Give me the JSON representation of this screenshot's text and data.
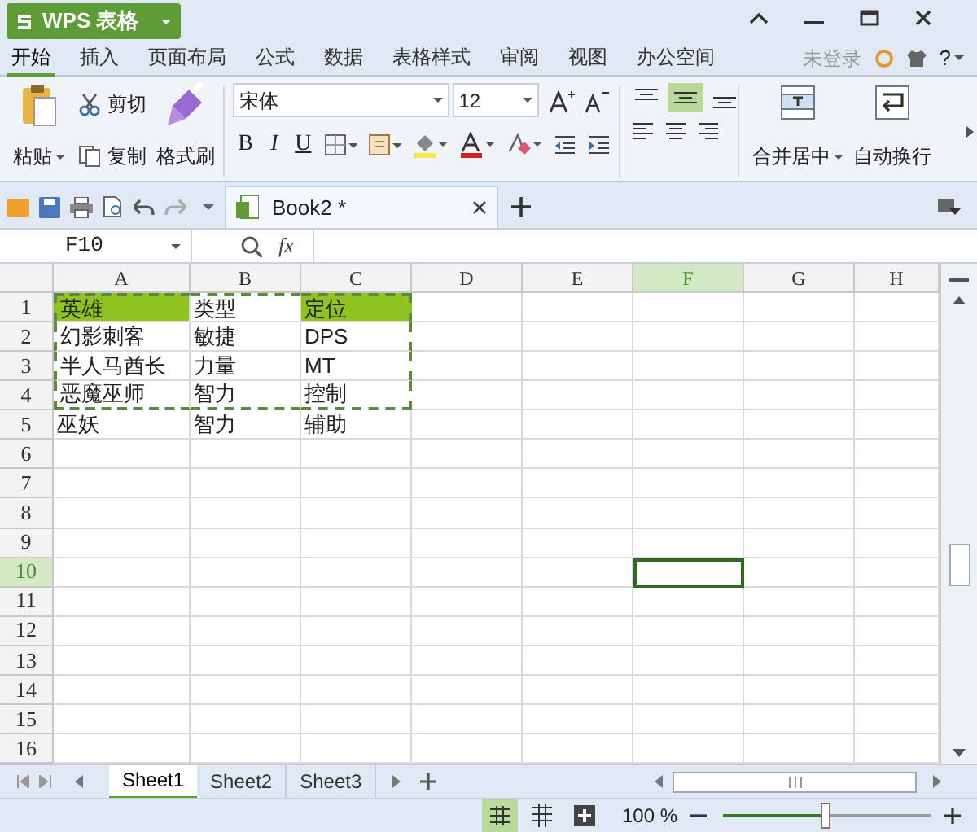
{
  "app_button": {
    "label": "WPS 表格"
  },
  "menu": [
    {
      "label": "开始",
      "selected": true
    },
    {
      "label": "插入",
      "selected": false
    },
    {
      "label": "页面布局",
      "selected": false
    },
    {
      "label": "公式",
      "selected": false
    },
    {
      "label": "数据",
      "selected": false
    },
    {
      "label": "表格样式",
      "selected": false
    },
    {
      "label": "审阅",
      "selected": false
    },
    {
      "label": "视图",
      "selected": false
    },
    {
      "label": "办公空间",
      "selected": false
    }
  ],
  "login": "未登录",
  "help": "?",
  "ribbon": {
    "paste": "粘贴",
    "cut": "剪切",
    "copy": "复制",
    "format_painter": "格式刷",
    "font_family": "宋体",
    "font_size": "12",
    "bold": "B",
    "italic": "I",
    "underline": "U",
    "vertical_align": [
      {
        "selected": false
      },
      {
        "selected": true
      },
      {
        "selected": false
      }
    ],
    "merge": "合并居中",
    "wrap": "自动换行"
  },
  "tabs": [
    {
      "label": "Book2 *",
      "selected": true
    }
  ],
  "name_box": "F10",
  "fx": "fx",
  "columns": [
    {
      "label": "A",
      "selected": false
    },
    {
      "label": "B",
      "selected": false
    },
    {
      "label": "C",
      "selected": false
    },
    {
      "label": "D",
      "selected": false
    },
    {
      "label": "E",
      "selected": false
    },
    {
      "label": "F",
      "selected": true
    },
    {
      "label": "G",
      "selected": false
    },
    {
      "label": "H",
      "selected": false
    }
  ],
  "rows": [
    {
      "label": "1",
      "selected": false
    },
    {
      "label": "2",
      "selected": false
    },
    {
      "label": "3",
      "selected": false
    },
    {
      "label": "4",
      "selected": false
    },
    {
      "label": "5",
      "selected": false
    },
    {
      "label": "6",
      "selected": false
    },
    {
      "label": "7",
      "selected": false
    },
    {
      "label": "8",
      "selected": false
    },
    {
      "label": "9",
      "selected": false
    },
    {
      "label": "10",
      "selected": true
    },
    {
      "label": "11",
      "selected": false
    },
    {
      "label": "12",
      "selected": false
    },
    {
      "label": "13",
      "selected": false
    },
    {
      "label": "14",
      "selected": false
    },
    {
      "label": "15",
      "selected": false
    },
    {
      "label": "16",
      "selected": false
    }
  ],
  "cells": [
    [
      {
        "text": "英雄",
        "highlighted": true,
        "copied": true
      },
      {
        "text": "类型",
        "highlighted": false,
        "copied": true
      },
      {
        "text": "定位",
        "highlighted": true,
        "copied": true
      }
    ],
    [
      {
        "text": "幻影刺客",
        "highlighted": false,
        "copied": true
      },
      {
        "text": "敏捷",
        "highlighted": false,
        "copied": true
      },
      {
        "text": "DPS",
        "highlighted": false,
        "copied": true
      }
    ],
    [
      {
        "text": "半人马酋长",
        "highlighted": false,
        "copied": true
      },
      {
        "text": "力量",
        "highlighted": false,
        "copied": true
      },
      {
        "text": "MT",
        "highlighted": false,
        "copied": true
      }
    ],
    [
      {
        "text": "恶魔巫师",
        "highlighted": false,
        "copied": true
      },
      {
        "text": "智力",
        "highlighted": false,
        "copied": true
      },
      {
        "text": "控制",
        "highlighted": false,
        "copied": true
      }
    ],
    [
      {
        "text": "巫妖",
        "highlighted": false,
        "copied": false
      },
      {
        "text": "智力",
        "highlighted": false,
        "copied": false
      },
      {
        "text": "辅助",
        "highlighted": false,
        "copied": false
      }
    ]
  ],
  "sheets": [
    {
      "label": "Sheet1",
      "selected": true
    },
    {
      "label": "Sheet2",
      "selected": false
    },
    {
      "label": "Sheet3",
      "selected": false
    }
  ],
  "status_bar": {
    "zoom": "100 %",
    "zoom_slider": {
      "level": 0.49
    }
  }
}
